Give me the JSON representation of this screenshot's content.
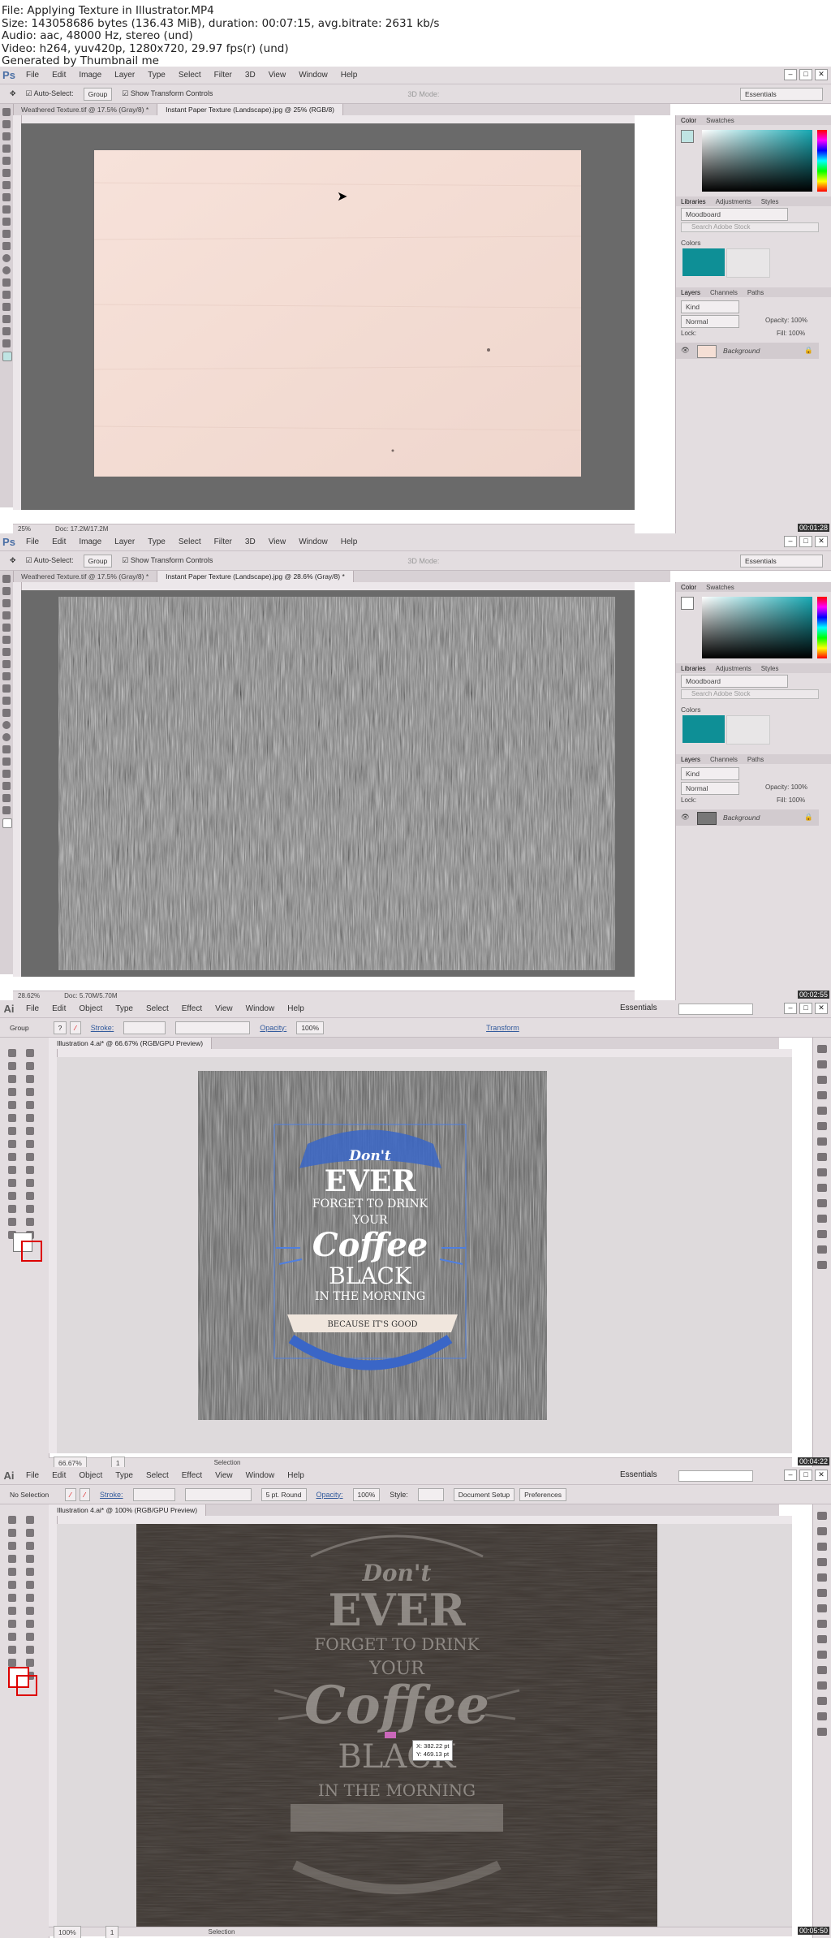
{
  "info": {
    "file": "File: Applying Texture in Illustrator.MP4",
    "size": "Size: 143058686 bytes (136.43 MiB), duration: 00:07:15, avg.bitrate: 2631 kb/s",
    "audio": "Audio: aac, 48000 Hz, stereo (und)",
    "video": "Video: h264, yuv420p, 1280x720, 29.97 fps(r) (und)",
    "generated": "Generated by Thumbnail me"
  },
  "ps": {
    "logo": "Ps",
    "menus": [
      "File",
      "Edit",
      "Image",
      "Layer",
      "Type",
      "Select",
      "Filter",
      "3D",
      "View",
      "Window",
      "Help"
    ],
    "options": {
      "auto_select": "Auto-Select:",
      "group": "Group",
      "transform_controls": "Show Transform Controls",
      "mode_3d": "3D Mode:",
      "workspace": "Essentials"
    },
    "panels": {
      "color_tabs": [
        "Color",
        "Swatches"
      ],
      "lib_tabs": [
        "Libraries",
        "Adjustments",
        "Styles"
      ],
      "library": "Moodboard",
      "search": "Search Adobe Stock",
      "colors_label": "Colors",
      "swatch_colors": [
        "#0e8f96",
        "#e8e6e7"
      ],
      "layer_tabs": [
        "Layers",
        "Channels",
        "Paths"
      ],
      "kind": "Kind",
      "blend": "Normal",
      "opacity_label": "Opacity:",
      "opacity": "100%",
      "lock": "Lock:",
      "fill_label": "Fill:",
      "fill": "100%",
      "layer_name": "Background"
    }
  },
  "frame1": {
    "tabs": [
      "Weathered Texture.tif @ 17.5% (Gray/8) *",
      "Instant Paper Texture (Landscape).jpg @ 25% (RGB/8)"
    ],
    "zoom": "25%",
    "doc": "Doc: 17.2M/17.2M",
    "timestamp": "00:01:28"
  },
  "frame2": {
    "tabs": [
      "Weathered Texture.tif @ 17.5% (Gray/8) *",
      "Instant Paper Texture (Landscape).jpg @ 28.6% (Gray/8) *"
    ],
    "zoom": "28.62%",
    "doc": "Doc: 5.70M/5.70M",
    "timestamp": "00:02:55"
  },
  "ai": {
    "logo": "Ai",
    "menus": [
      "File",
      "Edit",
      "Object",
      "Type",
      "Select",
      "Effect",
      "View",
      "Window",
      "Help"
    ],
    "workspace": "Essentials",
    "right_icons": [
      "swatch-panel-icon",
      "brush-panel-icon",
      "symbols-icon",
      "stroke-icon",
      "gradient-icon",
      "transparency-icon",
      "appearance-icon",
      "graphic-styles-icon",
      "layers-icon",
      "artboards-icon",
      "align-icon",
      "transform-icon",
      "pathfinder-icon"
    ]
  },
  "frame3": {
    "ctrl": {
      "group": "Group",
      "stroke": "Stroke:",
      "opacity": "Opacity:",
      "opacity_val": "100%",
      "transform": "Transform"
    },
    "tab": "Illustration 4.ai* @ 66.67% (RGB/GPU Preview)",
    "zoom": "66.67%",
    "page": "1",
    "mode": "Selection",
    "timestamp": "00:04:22",
    "poster": {
      "line1": "Don't",
      "line2": "EVER",
      "line3": "FORGET TO DRINK",
      "line4": "YOUR",
      "line5": "Coffee",
      "line6": "BLACK",
      "line7": "IN THE MORNING",
      "ribbon": "BECAUSE IT'S GOOD"
    }
  },
  "frame4": {
    "ctrl": {
      "no_selection": "No Selection",
      "stroke": "Stroke:",
      "brush": "5 pt. Round",
      "opacity": "Opacity:",
      "opacity_val": "100%",
      "style": "Style:",
      "doc_setup": "Document Setup",
      "prefs": "Preferences"
    },
    "tab": "Illustration 4.ai* @ 100% (RGB/GPU Preview)",
    "zoom": "100%",
    "page": "1",
    "mode": "Selection",
    "timestamp": "00:05:50",
    "tooltip_x": "X: 382.22 pt",
    "tooltip_y": "Y: 469.13 pt",
    "poster": {
      "line1": "Don't",
      "line2": "EVER",
      "line3": "FORGET TO DRINK",
      "line4": "YOUR",
      "line5": "Coffee",
      "line6": "BLACK",
      "line7": "IN THE MORNING"
    }
  }
}
